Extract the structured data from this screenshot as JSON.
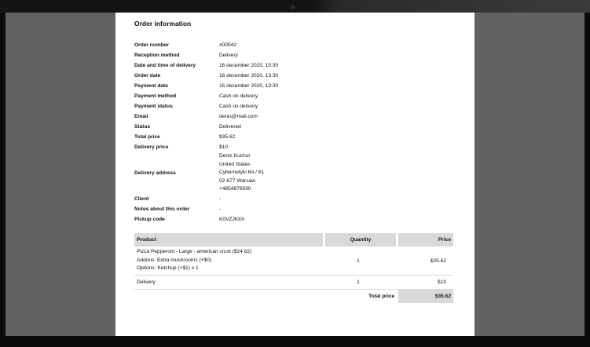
{
  "order": {
    "title": "Order information",
    "fields": [
      {
        "label": "Order number",
        "value": "#00042"
      },
      {
        "label": "Reception method",
        "value": "Delivery"
      },
      {
        "label": "Date and time of delivery",
        "value": "16 december 2020, 15:30"
      },
      {
        "label": "Order date",
        "value": "16 december 2020, 13:30"
      },
      {
        "label": "Payment date",
        "value": "16 december 2020, 13:30"
      },
      {
        "label": "Payment method",
        "value": "Cash on delivery"
      },
      {
        "label": "Payment status",
        "value": "Cash on delivery"
      },
      {
        "label": "Email",
        "value": "denis@mail.com"
      },
      {
        "label": "Status",
        "value": "Delivered"
      },
      {
        "label": "Total price",
        "value": "$35.62"
      },
      {
        "label": "Delivery price",
        "value": "$10"
      }
    ],
    "delivery_address": {
      "label": "Delivery address",
      "lines": [
        "Denis Kuchur",
        "United States",
        "Cybernetyki 6A / 61",
        "02-677 Warsaw",
        "+4854876590"
      ]
    },
    "fields_after": [
      {
        "label": "Client",
        "value": "-"
      },
      {
        "label": "Notes about this order",
        "value": "-"
      },
      {
        "label": "Pickup code",
        "value": "K0VZJK8X"
      }
    ]
  },
  "table": {
    "headers": {
      "product": "Product",
      "quantity": "Quantity",
      "price": "Price"
    },
    "rows": [
      {
        "product_lines": [
          "Pizza Pepperoni - Large - american crust ($24.62)",
          "Addons: Extra mushrooms (+$0)",
          "Options: Ketchup (+$1) x 1"
        ],
        "quantity": "1",
        "price": "$25.62"
      },
      {
        "product_lines": [
          "Delivery"
        ],
        "quantity": "1",
        "price": "$10"
      }
    ],
    "total_label": "Total price",
    "total_value": "$35.62"
  }
}
